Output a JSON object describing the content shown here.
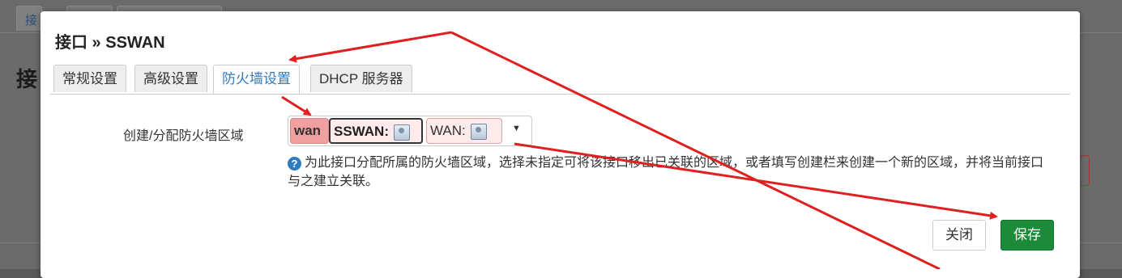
{
  "background": {
    "tab_fragment": "接",
    "heading_fragment": "接"
  },
  "modal": {
    "title": "接口 » SSWAN",
    "tabs": [
      {
        "label": "常规设置",
        "active": false
      },
      {
        "label": "高级设置",
        "active": false
      },
      {
        "label": "防火墙设置",
        "active": true
      },
      {
        "label": "DHCP 服务器",
        "active": false
      }
    ],
    "field": {
      "label": "创建/分配防火墙区域",
      "zones": [
        {
          "name": "wan"
        },
        {
          "name": "SSWAN:"
        },
        {
          "name": "WAN:"
        }
      ],
      "help": "为此接口分配所属的防火墙区域，选择未指定可将该接口移出已关联的区域，或者填写创建栏来创建一个新的区域，并将当前接口与之建立关联。"
    },
    "buttons": {
      "close": "关闭",
      "save": "保存"
    }
  },
  "colors": {
    "annotation_arrow": "#e02020",
    "save_button": "#1d8a3a",
    "active_tab": "#2f7bbf"
  }
}
